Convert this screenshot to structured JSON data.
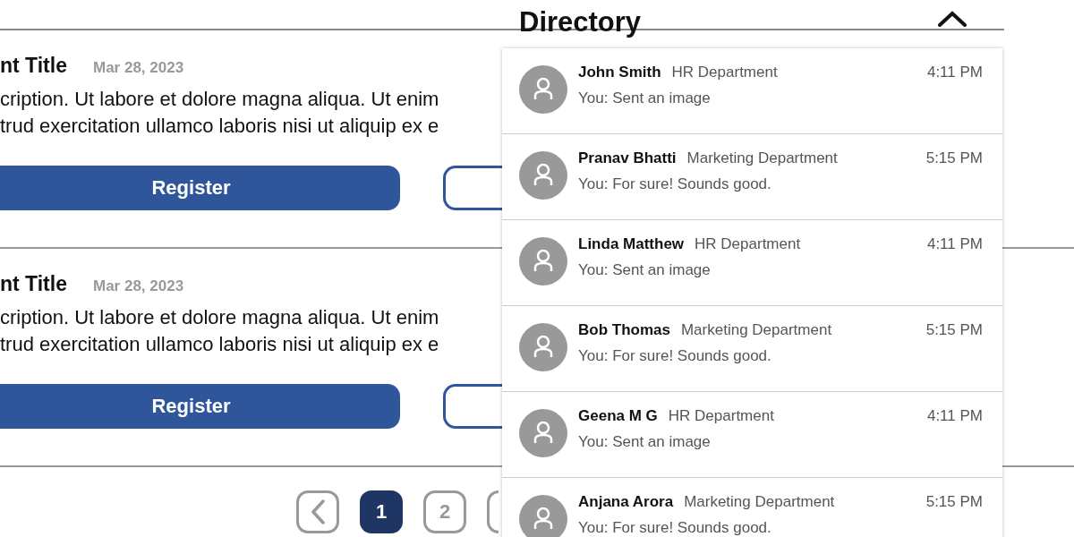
{
  "events": [
    {
      "title": "nt Title",
      "date": "Mar 28, 2023",
      "description": [
        "cription. Ut labore et dolore magna aliqua. Ut enim",
        "trud exercitation ullamco laboris nisi ut aliquip ex e"
      ],
      "button": "Register"
    },
    {
      "title": "nt Title",
      "date": "Mar 28, 2023",
      "description": [
        "cription. Ut labore et dolore magna aliqua. Ut enim",
        "trud exercitation ullamco laboris nisi ut aliquip ex e"
      ],
      "button": "Register"
    }
  ],
  "pagination": {
    "pages": [
      {
        "label": "1",
        "selected": true
      },
      {
        "label": "2",
        "selected": false
      }
    ]
  },
  "directory": {
    "title": "Directory",
    "expanded": true,
    "contacts": [
      {
        "name": "John Smith",
        "department": "HR Department",
        "time": "4:11 PM",
        "message": "You: Sent an image"
      },
      {
        "name": "Pranav Bhatti",
        "department": "Marketing Department",
        "time": "5:15 PM",
        "message": "You: For sure! Sounds good."
      },
      {
        "name": "Linda Matthew",
        "department": "HR Department",
        "time": "4:11 PM",
        "message": "You: Sent an image"
      },
      {
        "name": "Bob Thomas",
        "department": "Marketing Department",
        "time": "5:15 PM",
        "message": "You: For sure! Sounds good."
      },
      {
        "name": "Geena M G",
        "department": "HR Department",
        "time": "4:11 PM",
        "message": "You: Sent an image"
      },
      {
        "name": "Anjana Arora",
        "department": "Marketing Department",
        "time": "5:15 PM",
        "message": "You: For sure! Sounds good."
      }
    ]
  }
}
